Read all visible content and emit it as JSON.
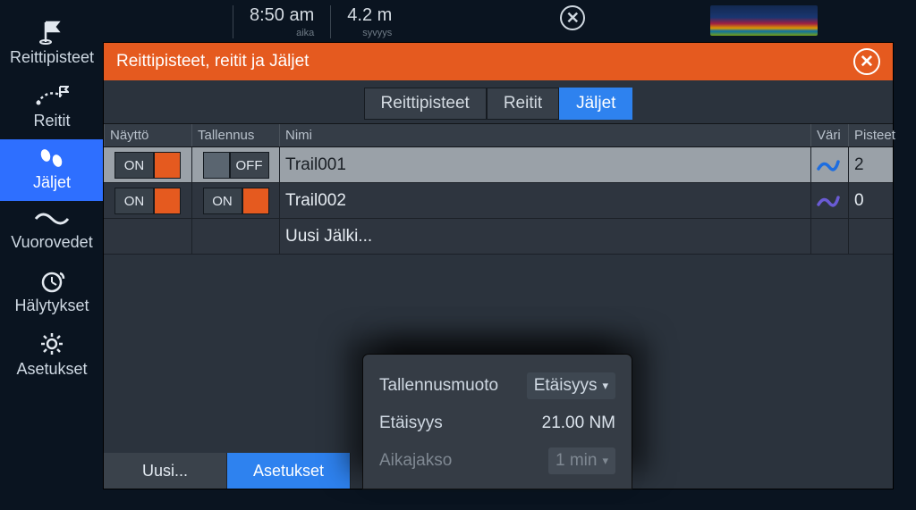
{
  "status": {
    "time": "8:50 am",
    "time_label": "aika",
    "depth": "4.2 m",
    "depth_label": "syvyys"
  },
  "sidebar": {
    "items": [
      {
        "label": "Reittipisteet"
      },
      {
        "label": "Reitit"
      },
      {
        "label": "Jäljet"
      },
      {
        "label": "Vuorovedet"
      },
      {
        "label": "Hälytykset"
      },
      {
        "label": "Asetukset"
      }
    ]
  },
  "dialog": {
    "title": "Reittipisteet, reitit ja Jäljet",
    "tabs": {
      "waypoints": "Reittipisteet",
      "routes": "Reitit",
      "trails": "Jäljet"
    },
    "headers": {
      "display": "Näyttö",
      "record": "Tallennus",
      "name": "Nimi",
      "color": "Väri",
      "points": "Pisteet"
    },
    "rows": [
      {
        "display": "ON",
        "record": "OFF",
        "name": "Trail001",
        "points": "2",
        "color": "#1d6de0"
      },
      {
        "display": "ON",
        "record": "ON",
        "name": "Trail002",
        "points": "0",
        "color": "#6a5bd4"
      }
    ],
    "new_trail": "Uusi Jälki...",
    "toggle": {
      "on": "ON",
      "off": "OFF"
    },
    "buttons": {
      "new": "Uusi...",
      "settings": "Asetukset"
    }
  },
  "popup": {
    "format_label": "Tallennusmuoto",
    "format_value": "Etäisyys",
    "distance_label": "Etäisyys",
    "distance_value": "21.00 NM",
    "period_label": "Aikajakso",
    "period_value": "1 min"
  }
}
